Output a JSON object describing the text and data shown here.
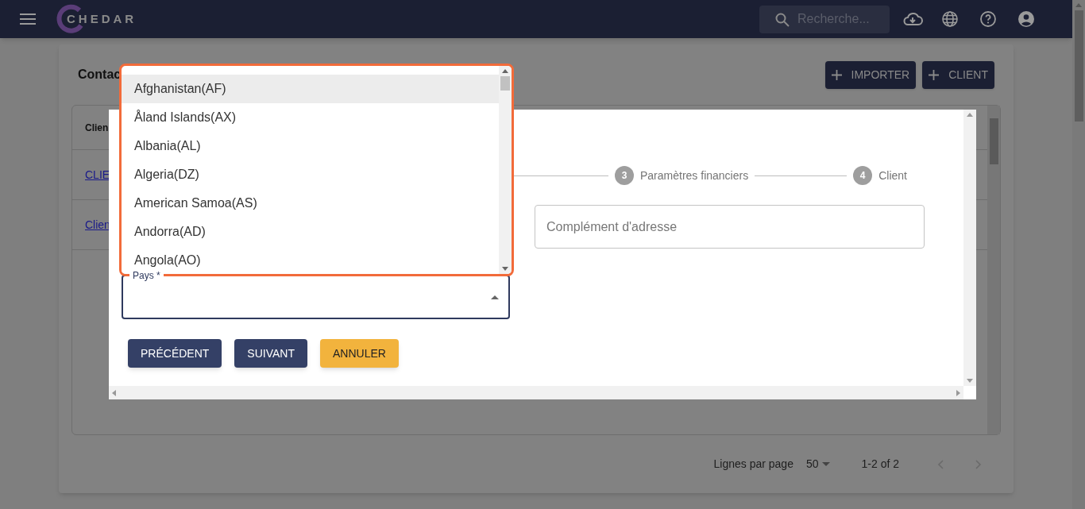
{
  "app_bar": {
    "logo": "CHEDAR",
    "search": {
      "placeholder": "Recherche..."
    }
  },
  "page": {
    "title": "Contac",
    "buttons": [
      "IMPORTER",
      "CLIENT"
    ],
    "table": {
      "column_1": "Clien",
      "rows": [
        "CLIE",
        "Clien"
      ]
    },
    "pagination": {
      "rows_label": "Lignes par page",
      "rows_per_page": "50",
      "range": "1-2 of 2"
    }
  },
  "dialog": {
    "steps": [
      {
        "number": "3",
        "label": "Paramètres financiers"
      },
      {
        "number": "4",
        "label": "Client"
      }
    ],
    "address_field": {
      "placeholder": "Complément d'adresse"
    },
    "country_field": {
      "label": "Pays *",
      "expanded": true
    },
    "buttons": [
      {
        "label": "PRÉCÉDENT",
        "kind": "primary"
      },
      {
        "label": "SUIVANT",
        "kind": "primary"
      },
      {
        "label": "ANNULER",
        "kind": "warning"
      }
    ]
  },
  "dropdown": {
    "options": [
      {
        "label": "Afghanistan(AF)",
        "highlighted": true
      },
      {
        "label": "Åland Islands(AX)",
        "highlighted": false
      },
      {
        "label": "Albania(AL)",
        "highlighted": false
      },
      {
        "label": "Algeria(DZ)",
        "highlighted": false
      },
      {
        "label": "American Samoa(AS)",
        "highlighted": false
      },
      {
        "label": "Andorra(AD)",
        "highlighted": false
      },
      {
        "label": "Angola(AO)",
        "highlighted": false
      }
    ]
  }
}
